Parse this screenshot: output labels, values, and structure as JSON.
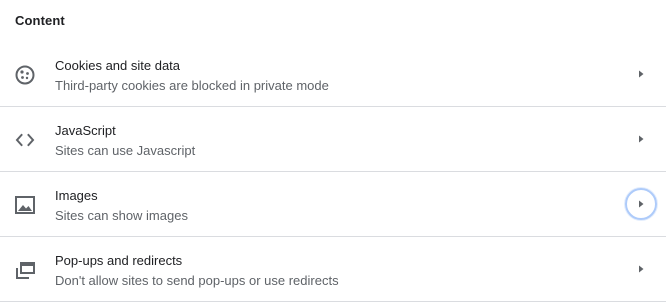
{
  "section": {
    "title": "Content"
  },
  "items": [
    {
      "icon": "cookie-icon",
      "title": "Cookies and site data",
      "subtitle": "Third-party cookies are blocked in private mode"
    },
    {
      "icon": "code-icon",
      "title": "JavaScript",
      "subtitle": "Sites can use Javascript"
    },
    {
      "icon": "image-icon",
      "title": "Images",
      "subtitle": "Sites can show images",
      "focused": true
    },
    {
      "icon": "popup-icon",
      "title": "Pop-ups and redirects",
      "subtitle": "Don't allow sites to send pop-ups or use redirects"
    }
  ],
  "colors": {
    "focus_ring": "#aecbfa",
    "divider": "#dadce0",
    "secondary_text": "#5f6368",
    "icon": "#5f6368"
  }
}
